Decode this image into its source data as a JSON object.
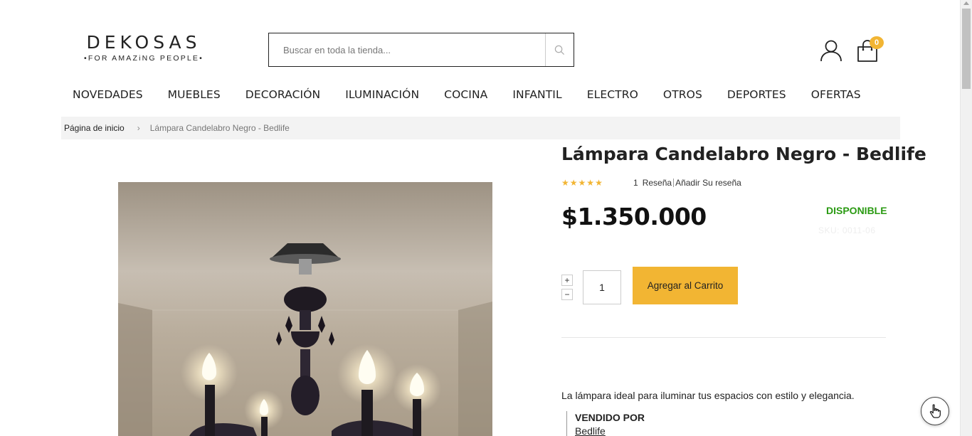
{
  "header": {
    "logo_main": "DEKOSAS",
    "logo_sub": "•FOR AMAZiNG PEOPLE•",
    "search_placeholder": "Buscar en toda la tienda...",
    "cart_count": "0"
  },
  "nav": {
    "items": [
      {
        "label": "NOVEDADES"
      },
      {
        "label": "MUEBLES"
      },
      {
        "label": "DECORACIÓN"
      },
      {
        "label": "ILUMINACIÓN"
      },
      {
        "label": "COCINA"
      },
      {
        "label": "INFANTIL"
      },
      {
        "label": "ELECTRO"
      },
      {
        "label": "OTROS"
      },
      {
        "label": "DEPORTES"
      },
      {
        "label": "OFERTAS"
      }
    ]
  },
  "breadcrumb": {
    "home": "Página de inicio",
    "separator": "›",
    "current": "Lámpara Candelabro Negro - Bedlife"
  },
  "product": {
    "title": "Lámpara Candelabro Negro - Bedlife",
    "rating_stars": 5,
    "review_count": "1",
    "review_label": "Reseña",
    "add_review_label": "Añadir Su reseña",
    "price": "$1.350.000",
    "stock_status": "DISPONIBLE",
    "sku_label": "SKU: 0011-06",
    "quantity": "1",
    "qty_plus": "+",
    "qty_minus": "−",
    "add_to_cart_label": "Agregar al Carrito",
    "description": "La lámpara ideal para iluminar tus espacios con estilo y elegancia.",
    "sold_by_label": "VENDIDO POR",
    "seller": "Bedlife"
  },
  "colors": {
    "accent": "#f2b533",
    "stock_green": "#2a9a12",
    "text": "#222222"
  }
}
